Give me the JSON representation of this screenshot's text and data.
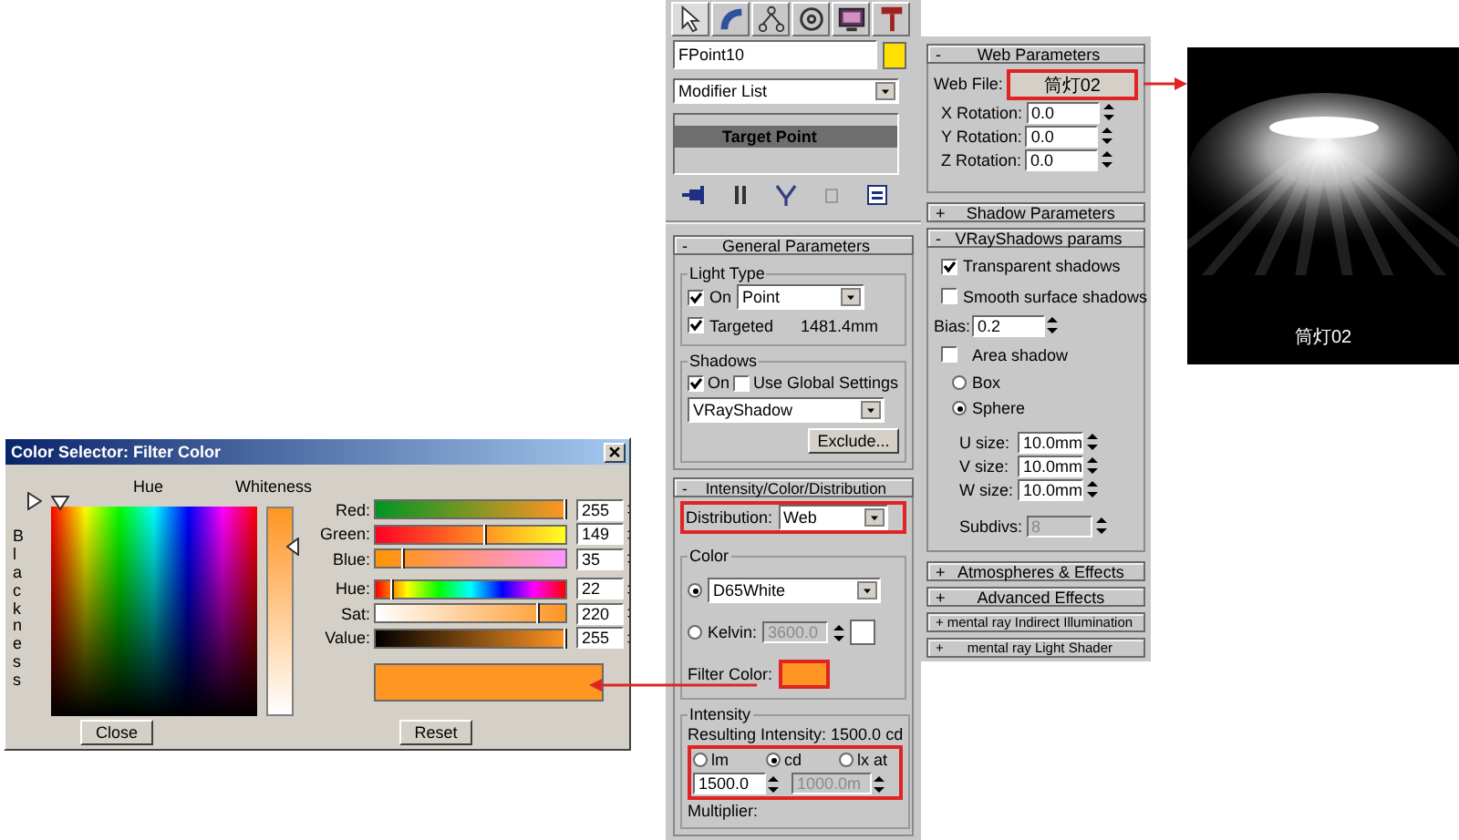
{
  "command_panel": {
    "tabs": [
      {
        "selected": true
      },
      {
        "selected": false
      },
      {
        "selected": false
      },
      {
        "selected": false
      },
      {
        "selected": false
      },
      {
        "selected": false
      }
    ],
    "object_name": "FPoint10",
    "modifier_list": "Modifier List",
    "stack": [
      {
        "label": "Target Point",
        "selected": true
      }
    ],
    "general_parameters": {
      "toggle": "-",
      "title": "General Parameters",
      "light_type": {
        "title": "Light Type",
        "on": {
          "label": "On",
          "checked": true
        },
        "type": "Point",
        "targeted": {
          "label": "Targeted",
          "checked": true
        },
        "distance": "1481.4mm"
      },
      "shadows": {
        "title": "Shadows",
        "on": {
          "label": "On",
          "checked": true
        },
        "use_global": {
          "label": "Use Global Settings",
          "checked": false
        },
        "type": "VRayShadow",
        "exclude_button": "Exclude..."
      }
    },
    "intensity_color_distribution": {
      "toggle": "-",
      "title": "Intensity/Color/Distribution",
      "distribution": {
        "label": "Distribution:",
        "value": "Web",
        "highlighted": true
      },
      "color": {
        "title": "Color",
        "preset": {
          "selected": true,
          "value": "D65White"
        },
        "kelvin": {
          "selected": false,
          "label": "Kelvin:",
          "value": "3600.0"
        },
        "filter_color": {
          "label": "Filter Color:",
          "highlighted": true
        }
      },
      "intensity": {
        "title": "Intensity",
        "resulting": "Resulting Intensity: 1500.0 cd",
        "highlighted": true,
        "units": [
          {
            "label": "lm",
            "selected": false
          },
          {
            "label": "cd",
            "selected": true
          },
          {
            "label": "lx at",
            "selected": false
          }
        ],
        "value": "1500.0",
        "distance": "1000.0m",
        "multiplier_label": "Multiplier:"
      }
    }
  },
  "side_panel": {
    "web_parameters": {
      "toggle": "-",
      "title": "Web Parameters",
      "web_file": {
        "label": "Web File:",
        "value": "筒灯02",
        "highlighted": true
      },
      "rotations": [
        {
          "label": "X Rotation:",
          "value": "0.0"
        },
        {
          "label": "Y Rotation:",
          "value": "0.0"
        },
        {
          "label": "Z Rotation:",
          "value": "0.0"
        }
      ]
    },
    "shadow_parameters": {
      "toggle": "+",
      "title": "Shadow Parameters"
    },
    "vray_shadows": {
      "toggle": "-",
      "title": "VRayShadows params",
      "transparent": {
        "label": "Transparent shadows",
        "checked": true
      },
      "smooth": {
        "label": "Smooth surface shadows",
        "checked": false
      },
      "bias": {
        "label": "Bias:",
        "value": "0.2"
      },
      "area": {
        "label": "Area shadow",
        "checked": false
      },
      "shapes": [
        {
          "label": "Box",
          "selected": false
        },
        {
          "label": "Sphere",
          "selected": true
        }
      ],
      "sizes": [
        {
          "label": "U size:",
          "value": "10.0mm"
        },
        {
          "label": "V size:",
          "value": "10.0mm"
        },
        {
          "label": "W size:",
          "value": "10.0mm"
        }
      ],
      "subdivs": {
        "label": "Subdivs:",
        "value": "8",
        "disabled": true
      }
    },
    "more_rollouts": [
      {
        "toggle": "+",
        "title": "Atmospheres & Effects"
      },
      {
        "toggle": "+",
        "title": "Advanced Effects"
      },
      {
        "toggle": "+",
        "title": "mental ray Indirect Illumination"
      },
      {
        "toggle": "+",
        "title": "mental ray Light Shader"
      }
    ]
  },
  "preview": {
    "kind": "picture",
    "caption": "筒灯02"
  },
  "color_selector": {
    "title": "Color Selector: Filter Color",
    "hue_label": "Hue",
    "whiteness_label": "Whiteness",
    "blackness_label": "Blackness",
    "channels": [
      {
        "kind": "red",
        "label": "Red:",
        "value": "255",
        "level": 1.0
      },
      {
        "kind": "green",
        "label": "Green:",
        "value": "149",
        "level": 0.58
      },
      {
        "kind": "blue",
        "label": "Blue:",
        "value": "35",
        "level": 0.14
      },
      {
        "kind": "hue",
        "label": "Hue:",
        "value": "22",
        "level": 0.09
      },
      {
        "kind": "sat",
        "label": "Sat:",
        "value": "220",
        "level": 0.86
      },
      {
        "kind": "value",
        "label": "Value:",
        "value": "255",
        "level": 1.0
      }
    ],
    "buttons": [
      {
        "label": "Close"
      },
      {
        "label": "Reset"
      }
    ]
  }
}
